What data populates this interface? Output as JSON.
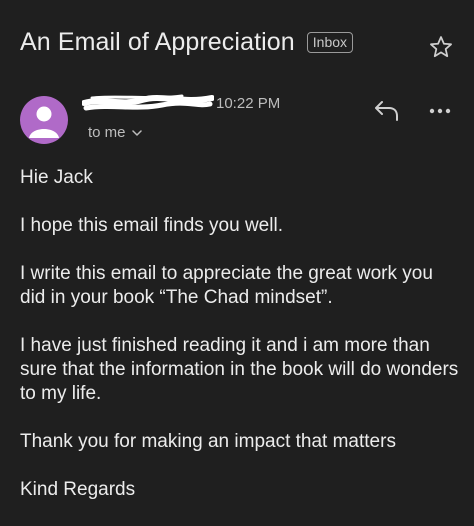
{
  "header": {
    "subject": "An Email of Appreciation",
    "label": "Inbox",
    "star_icon": "star-outline-icon"
  },
  "message": {
    "sender_redacted": true,
    "time": "10:22 PM",
    "recipient": "to me",
    "recipient_icon": "chevron-down-icon",
    "avatar_icon": "person-icon",
    "avatar_color": "#b06ac8",
    "actions": {
      "reply_icon": "reply-icon",
      "more_icon": "more-horizontal-icon"
    }
  },
  "body": {
    "paragraphs": [
      "Hie Jack",
      "I hope this email finds you well.",
      "I write this email to appreciate the great work you did in your book “The Chad mindset”.",
      "I have just finished reading it and i am more than sure that the information in the book will do wonders to my life.",
      "Thank you for making an impact that matters",
      "Kind Regards"
    ]
  },
  "colors": {
    "background": "#1f1f1f",
    "text": "#ececec",
    "muted": "#bdbdbd"
  }
}
